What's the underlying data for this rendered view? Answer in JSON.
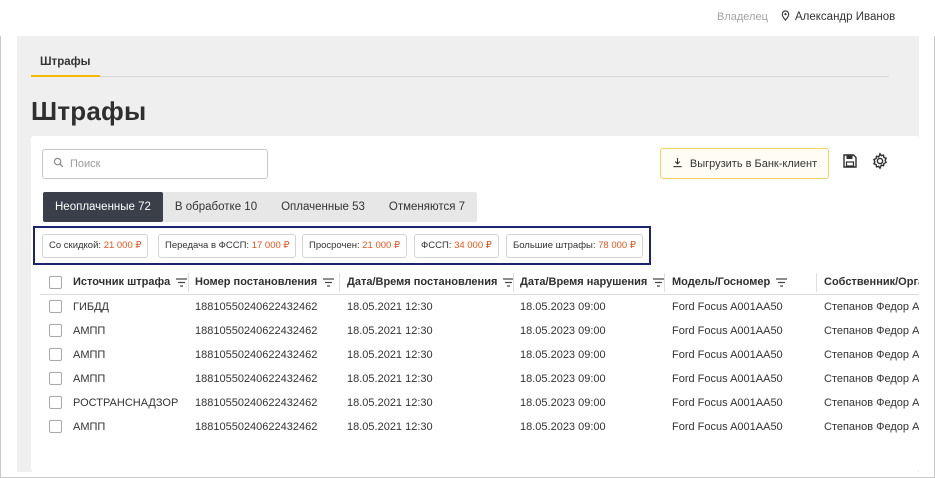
{
  "header": {
    "owner_label": "Владелец",
    "user_name": "Александр Иванов"
  },
  "page_tab": "Штрафы",
  "page_title": "Штрафы",
  "search": {
    "placeholder": "Поиск",
    "value": ""
  },
  "toolbar": {
    "export_label": "Выгрузить в Банк-клиент"
  },
  "tabs": [
    {
      "label": "Неоплаченные 72",
      "active": true
    },
    {
      "label": "В обработке 10",
      "active": false
    },
    {
      "label": "Оплаченные 53",
      "active": false
    },
    {
      "label": "Отменяются 7",
      "active": false
    }
  ],
  "chips": [
    {
      "label": "Со скидкой:",
      "amount": "21 000 ₽"
    },
    {
      "label": "Передача в ФССП:",
      "amount": "17 000 ₽"
    },
    {
      "label": "Просрочен:",
      "amount": "21 000 ₽"
    },
    {
      "label": "ФССП:",
      "amount": "34 000 ₽"
    },
    {
      "label": "Большие штрафы:",
      "amount": "78 000 ₽"
    }
  ],
  "table": {
    "columns": [
      "Источник штрафа",
      "Номер постановления",
      "Дата/Время постановления",
      "Дата/Время нарушения",
      "Модель/Госномер",
      "Собственник/Орга"
    ],
    "rows": [
      [
        "ГИБДД",
        "18810550240622432462",
        "18.05.2021 12:30",
        "18.05.2023 09:00",
        "Ford Focus A001AA50",
        "Степанов Федор А."
      ],
      [
        "АМПП",
        "18810550240622432462",
        "18.05.2021 12:30",
        "18.05.2023 09:00",
        "Ford Focus A001AA50",
        "Степанов Федор А."
      ],
      [
        "АМПП",
        "18810550240622432462",
        "18.05.2021 12:30",
        "18.05.2023 09:00",
        "Ford Focus A001AA50",
        "Степанов Федор А."
      ],
      [
        "АМПП",
        "18810550240622432462",
        "18.05.2021 12:30",
        "18.05.2023 09:00",
        "Ford Focus A001AA50",
        "Степанов Федор А."
      ],
      [
        "РОСТРАНСНАДЗОР",
        "18810550240622432462",
        "18.05.2021 12:30",
        "18.05.2023 09:00",
        "Ford Focus A001AA50",
        "Степанов Федор А."
      ],
      [
        "АМПП",
        "18810550240622432462",
        "18.05.2021 12:30",
        "18.05.2023 09:00",
        "Ford Focus A001AA50",
        "Степанов Федор А."
      ]
    ]
  },
  "colors": {
    "accent": "#f4b700",
    "active_tab": "#3a3f4a",
    "amount": "#e8541b",
    "highlight_border": "#1c2370"
  },
  "icons": {
    "user": "location-pin-icon",
    "search": "search-icon",
    "export": "download-icon",
    "save": "floppy-disk-icon",
    "settings": "gear-icon",
    "column_filter": "filter-icon"
  }
}
